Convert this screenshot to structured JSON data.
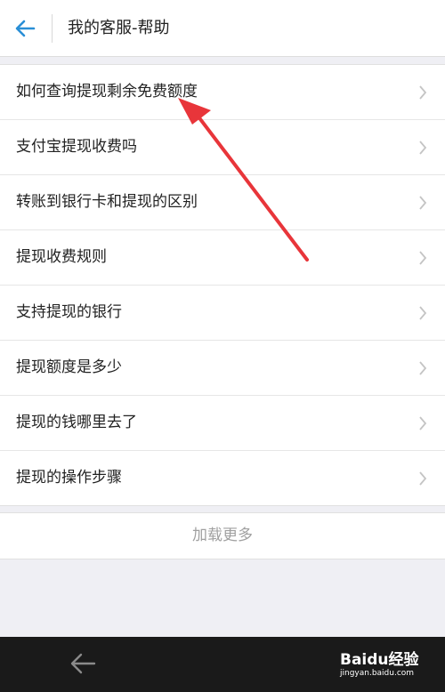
{
  "header": {
    "title": "我的客服-帮助"
  },
  "items": [
    {
      "label": "如何查询提现剩余免费额度"
    },
    {
      "label": "支付宝提现收费吗"
    },
    {
      "label": "转账到银行卡和提现的区别"
    },
    {
      "label": "提现收费规则"
    },
    {
      "label": "支持提现的银行"
    },
    {
      "label": "提现额度是多少"
    },
    {
      "label": "提现的钱哪里去了"
    },
    {
      "label": "提现的操作步骤"
    }
  ],
  "load_more": "加载更多",
  "watermark": {
    "logo": "Baidu经验",
    "url": "jingyan.baidu.com"
  },
  "colors": {
    "accent": "#2a8fd6",
    "annotation": "#e8353a",
    "nav_bar": "#1a1a1a"
  }
}
